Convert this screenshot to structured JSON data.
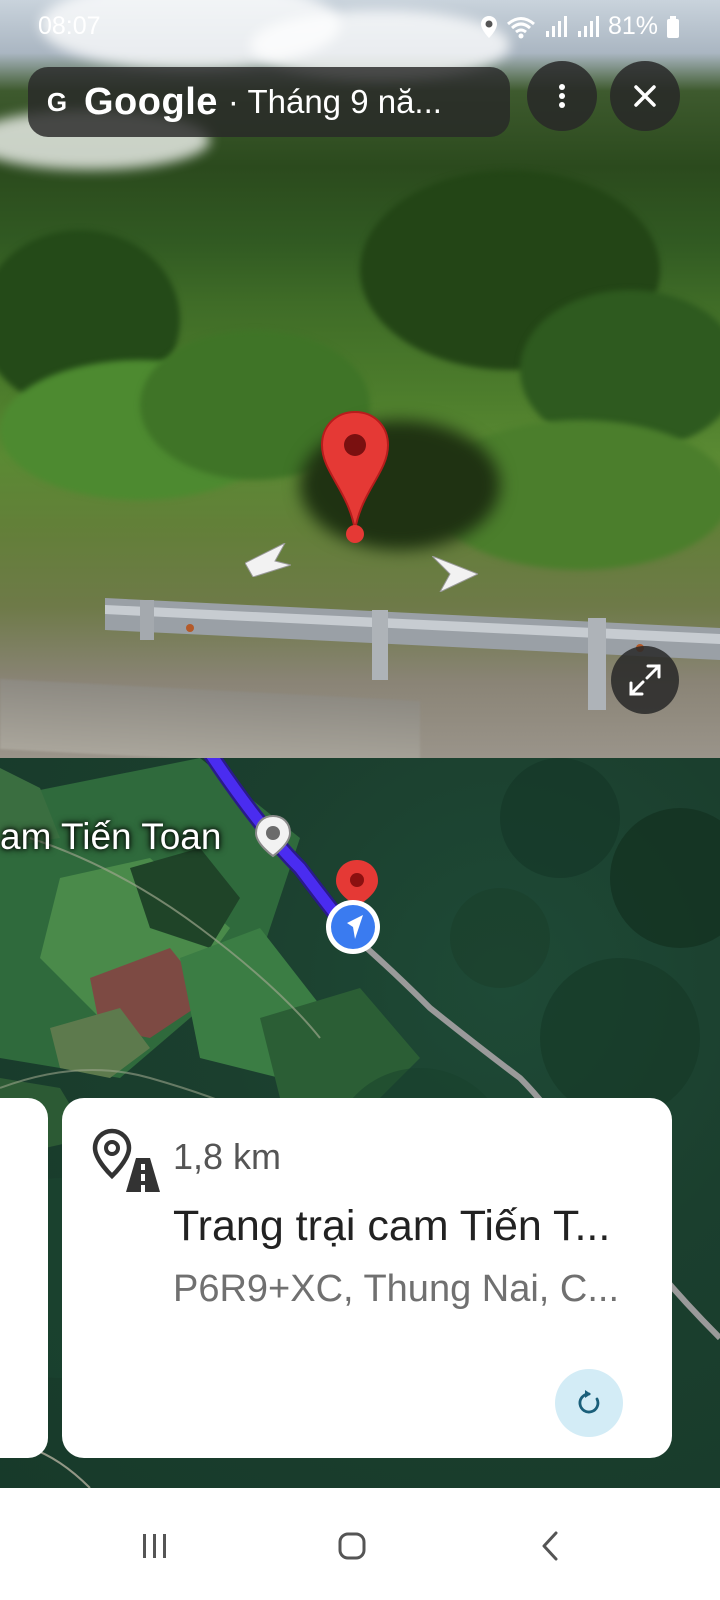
{
  "status_bar": {
    "time": "08:07",
    "battery": "81%",
    "icons": [
      "location-icon",
      "wifi-icon",
      "signal-icon",
      "signal-icon",
      "battery-icon"
    ]
  },
  "street_view": {
    "brand": "Google",
    "date_text": "· Tháng 9 nă...",
    "icons": {
      "more": "more-vert-icon",
      "close": "close-icon",
      "expand": "expand-icon"
    }
  },
  "map": {
    "place_label": "am Tiến Toan",
    "colors": {
      "route": "#3b1fe0",
      "pin": "#e02b20",
      "location_dot": "#3a7bf0"
    }
  },
  "place_card": {
    "distance": "1,8 km",
    "title": "Trang trại cam Tiến T...",
    "address": "P6R9+XC, Thung Nai, C...",
    "icons": {
      "type": "place-road-icon",
      "refresh": "refresh-icon"
    }
  },
  "nav_bar": {
    "icons": [
      "recents-icon",
      "home-icon",
      "back-icon"
    ]
  }
}
